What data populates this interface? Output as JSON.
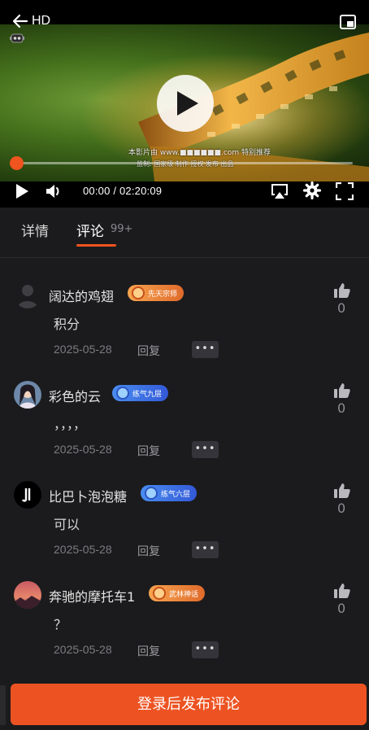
{
  "player": {
    "back_label": "HD",
    "watermark_line1": "本影片由 www.■■■■■■.com 特别推荐",
    "watermark_line2": "监制: 国家级 制作 授权 发布 出品",
    "progress_fraction": 0.0,
    "time_current": "00:00",
    "time_separator": "/",
    "time_total": "02:20:09",
    "accent_color": "#f0541f"
  },
  "tabs": {
    "detail": "详情",
    "comment": "评论",
    "comment_count": "99+"
  },
  "comments": [
    {
      "user": "阔达的鸡翅",
      "badge": "先天宗师",
      "badge_style": "orange",
      "text": "积分",
      "date": "2025-05-28",
      "reply": "回复",
      "more": "•••",
      "likes": "0"
    },
    {
      "user": "彩色的云",
      "badge": "练气九层",
      "badge_style": "blue",
      "text": "，，，，",
      "date": "2025-05-28",
      "reply": "回复",
      "more": "•••",
      "likes": "0"
    },
    {
      "user": "比巴卜泡泡糖",
      "badge": "练气六层",
      "badge_style": "blue",
      "text": "可以",
      "date": "2025-05-28",
      "reply": "回复",
      "more": "•••",
      "likes": "0"
    },
    {
      "user": "奔驰的摩托车1",
      "badge": "武林神话",
      "badge_style": "orange",
      "text": "？",
      "date": "2025-05-28",
      "reply": "回复",
      "more": "•••",
      "likes": "0"
    }
  ],
  "footer": {
    "post_label": "登录后发布评论",
    "button_color": "#ed5322"
  }
}
